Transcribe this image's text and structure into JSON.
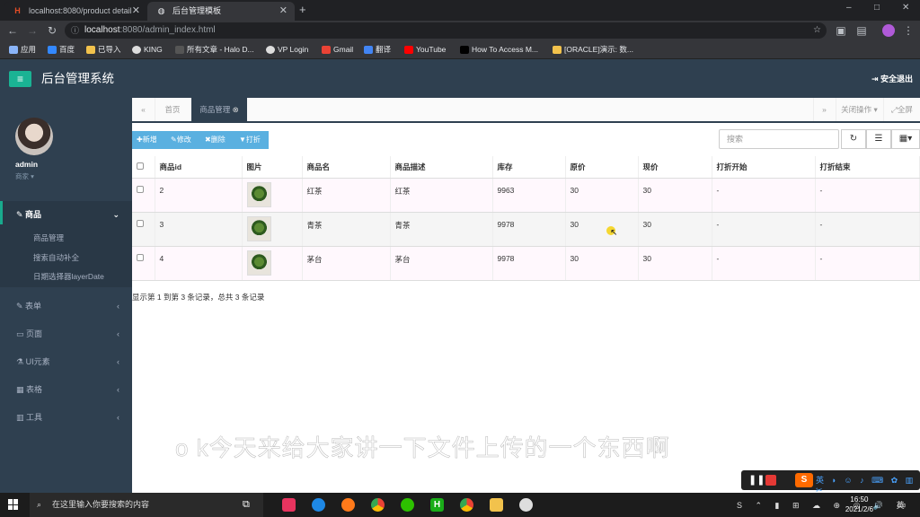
{
  "browser": {
    "tabs": [
      {
        "title": "localhost:8080/product detail",
        "favicon": "H",
        "favicon_color": "#e44d26"
      },
      {
        "title": "后台管理模板",
        "favicon": "globe-icon"
      }
    ],
    "url_host": "localhost",
    "url_path": ":8080/admin_index.html",
    "bookmarks": [
      "应用",
      "百度",
      "已导入",
      "KING",
      "所有文章 - Halo D...",
      "VP Login",
      "Gmail",
      "翻译",
      "YouTube",
      "How To Access M...",
      "[ORACLE]演示: 数..."
    ]
  },
  "header": {
    "title": "后台管理系统",
    "logout": "安全退出",
    "menu_icon": "hamburger-icon"
  },
  "user": {
    "name": "admin",
    "role": "商家 ▾"
  },
  "sidebar": {
    "items": [
      {
        "label": "商品",
        "icon": "edit-icon",
        "active": true
      },
      {
        "label": "表单",
        "icon": "edit-icon"
      },
      {
        "label": "页面",
        "icon": "desktop-icon"
      },
      {
        "label": "UI元素",
        "icon": "flask-icon"
      },
      {
        "label": "表格",
        "icon": "table-icon"
      },
      {
        "label": "工具",
        "icon": "columns-icon"
      }
    ],
    "sub_items": [
      "商品管理",
      "搜索自动补全",
      "日期选择器layerDate"
    ]
  },
  "content_tabs": {
    "home": "首页",
    "active": "商品管理",
    "close_ops": "关闭操作",
    "fullscreen": "全屏"
  },
  "toolbar": {
    "add": "新增",
    "edit": "修改",
    "delete": "删除",
    "print": "打折"
  },
  "search": {
    "placeholder": "搜索"
  },
  "table": {
    "headers": [
      "商品id",
      "图片",
      "商品名",
      "商品描述",
      "库存",
      "原价",
      "现价",
      "打折开始",
      "打折结束"
    ],
    "rows": [
      [
        "2",
        "",
        "红茶",
        "红茶",
        "9963",
        "30",
        "30",
        "-",
        "-"
      ],
      [
        "3",
        "",
        "青茶",
        "青茶",
        "9978",
        "30",
        "30",
        "-",
        "-"
      ],
      [
        "4",
        "",
        "茅台",
        "茅台",
        "9978",
        "30",
        "30",
        "-",
        "-"
      ]
    ]
  },
  "pagination_text": "显示第 1 到第 3 条记录，总共 3 条记录",
  "subtitle": "o k今天来给大家讲一下文件上传的一个东西啊",
  "taskbar": {
    "search_placeholder": "在这里输入你要搜索的内容",
    "time": "16:50",
    "date": "2021/2/6"
  },
  "colors": {
    "sidebar": "#2f4050",
    "accent": "#1ab394",
    "button": "#5ab0e0"
  }
}
